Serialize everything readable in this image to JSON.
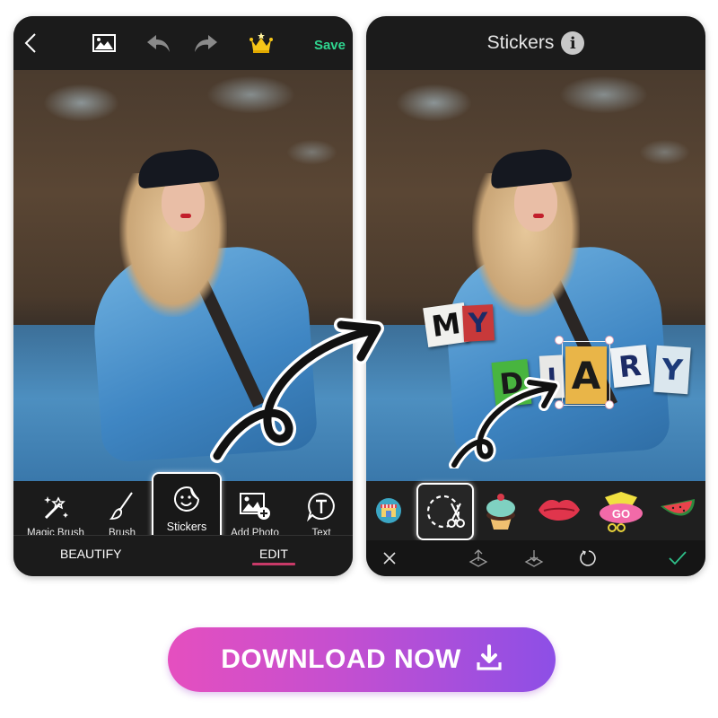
{
  "left_screen": {
    "topbar": {
      "icons": [
        "back-chevron-icon",
        "image-icon",
        "undo-icon",
        "redo-icon",
        "crown-icon"
      ],
      "save_label": "Save",
      "save_color": "#2fd58f"
    },
    "tools": [
      {
        "label": "Magic Brush",
        "icon": "magic-wand-icon"
      },
      {
        "label": "Brush",
        "icon": "brush-icon"
      },
      {
        "label": "Stickers",
        "icon": "sticker-smiley-icon",
        "selected": true
      },
      {
        "label": "Add Photo",
        "icon": "add-photo-icon"
      },
      {
        "label": "Text",
        "icon": "text-bubble-icon"
      }
    ],
    "tabs": [
      {
        "label": "BEAUTIFY",
        "active": false
      },
      {
        "label": "EDIT",
        "active": true
      }
    ],
    "active_tab_color": "#c83a68"
  },
  "right_screen": {
    "title": "Stickers",
    "info_glyph": "i",
    "photo_stickers": {
      "word1": [
        "M",
        "Y"
      ],
      "word2": [
        "D",
        "I",
        "A",
        "R",
        "Y"
      ],
      "selected_letter": "A"
    },
    "sticker_tray": [
      {
        "name": "sticker-store-icon"
      },
      {
        "name": "cutout-scissors-icon",
        "selected": true
      },
      {
        "name": "cupcake-sticker"
      },
      {
        "name": "lips-sticker"
      },
      {
        "name": "hello-go-sticker",
        "text": "GO"
      },
      {
        "name": "watermelon-sticker"
      }
    ],
    "actions": [
      "close-icon",
      "bring-forward-icon",
      "send-backward-icon",
      "reset-icon",
      "confirm-check-icon"
    ],
    "confirm_color": "#2fc08a"
  },
  "cta": {
    "label": "DOWNLOAD NOW",
    "icon": "download-icon"
  }
}
